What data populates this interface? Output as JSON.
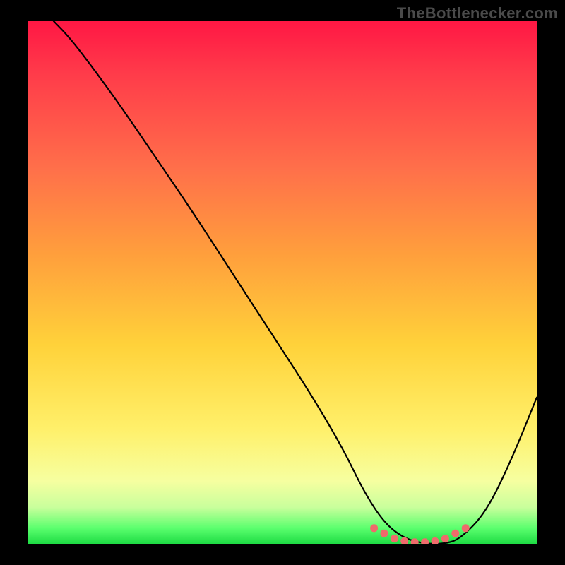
{
  "watermark": "TheBottlenecker.com",
  "chart_data": {
    "type": "line",
    "title": "",
    "xlabel": "",
    "ylabel": "",
    "xlim": [
      0,
      100
    ],
    "ylim": [
      0,
      100
    ],
    "series": [
      {
        "name": "bottleneck-curve",
        "x": [
          5,
          8,
          12,
          18,
          25,
          32,
          40,
          48,
          56,
          62,
          66,
          70,
          74,
          78,
          82,
          85,
          90,
          95,
          100
        ],
        "y": [
          100,
          97,
          92,
          84,
          74,
          64,
          52,
          40,
          28,
          18,
          10,
          4,
          1,
          0,
          0,
          1,
          6,
          16,
          28
        ]
      }
    ],
    "markers": {
      "name": "highlight-range",
      "x": [
        68,
        70,
        72,
        74,
        76,
        78,
        80,
        82,
        84,
        86
      ],
      "y": [
        3,
        2,
        1,
        0.5,
        0.3,
        0.3,
        0.5,
        1,
        2,
        3
      ]
    },
    "gradient_stops": [
      {
        "pos": 0.0,
        "color": "#ff1744"
      },
      {
        "pos": 0.1,
        "color": "#ff3b4a"
      },
      {
        "pos": 0.28,
        "color": "#ff6f4a"
      },
      {
        "pos": 0.45,
        "color": "#ffa03c"
      },
      {
        "pos": 0.62,
        "color": "#ffd23a"
      },
      {
        "pos": 0.78,
        "color": "#fff06a"
      },
      {
        "pos": 0.88,
        "color": "#f6ffa0"
      },
      {
        "pos": 0.93,
        "color": "#c9ff9c"
      },
      {
        "pos": 0.97,
        "color": "#5bff6e"
      },
      {
        "pos": 1.0,
        "color": "#1edc44"
      }
    ],
    "curve_color": "#000000",
    "marker_color": "#ef6b6b"
  }
}
